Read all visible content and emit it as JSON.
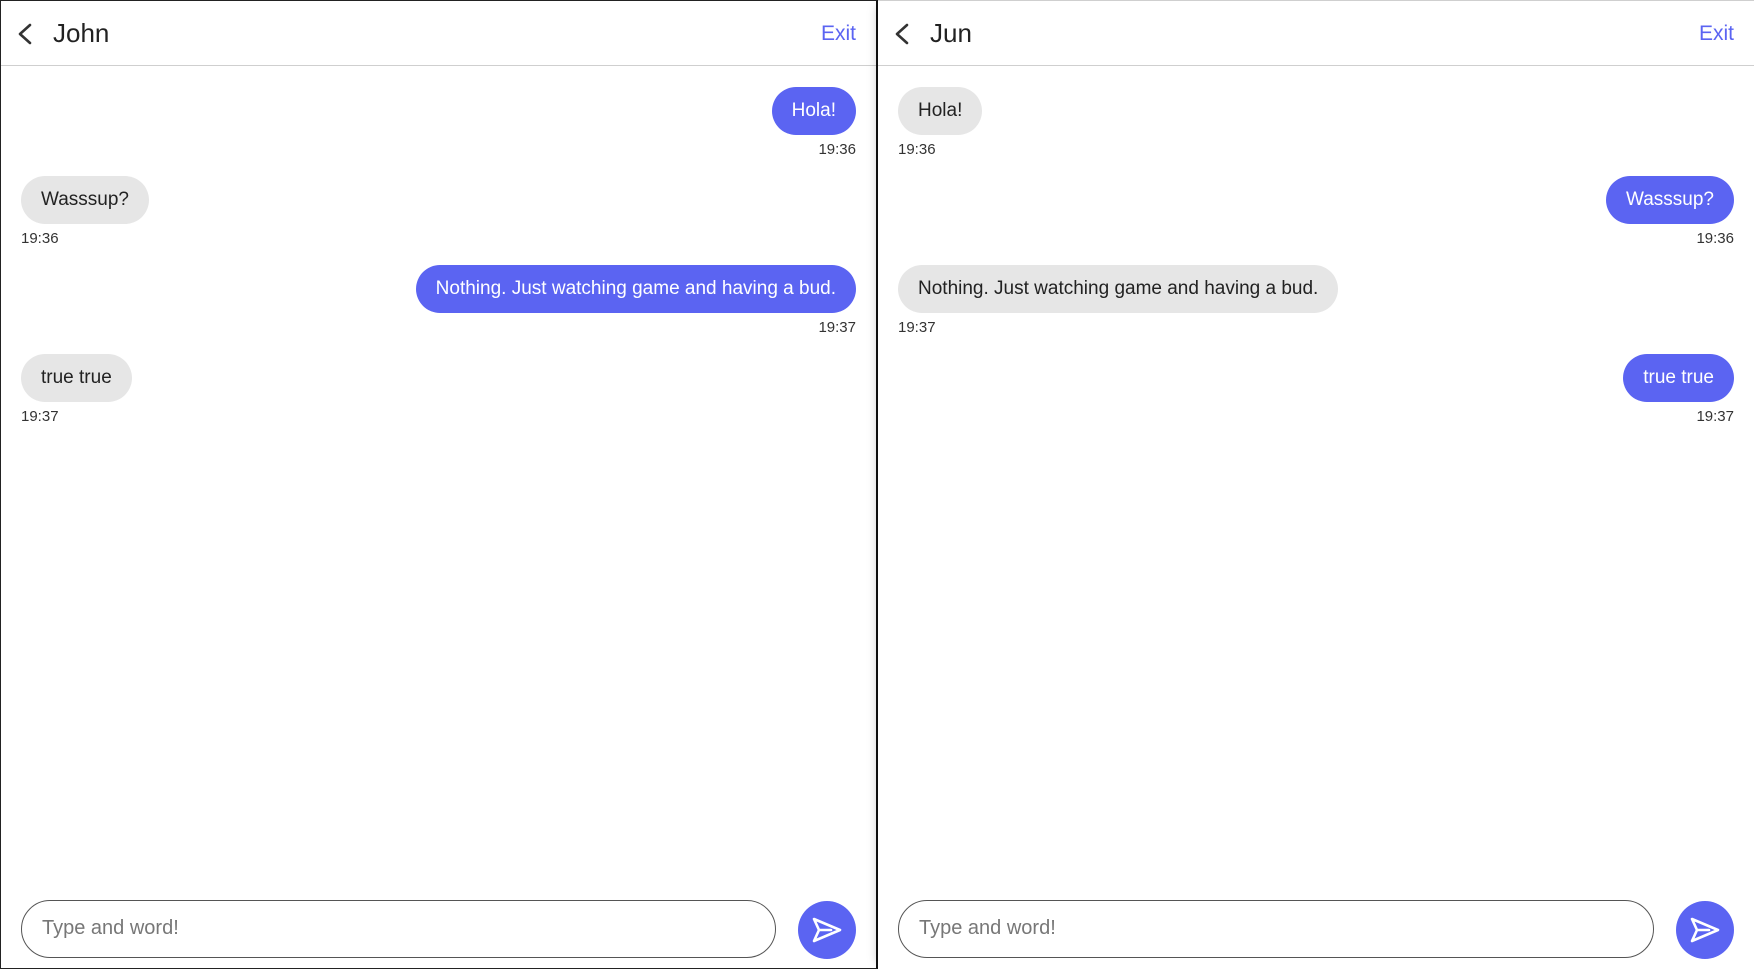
{
  "colors": {
    "accent": "#5b64f2",
    "received_bubble": "#e6e6e6",
    "text": "#222222"
  },
  "panes": [
    {
      "contact_name": "John",
      "exit_label": "Exit",
      "input_placeholder": "Type and word!",
      "input_value": "",
      "messages": [
        {
          "direction": "sent",
          "text": "Hola!",
          "time": "19:36"
        },
        {
          "direction": "received",
          "text": "Wasssup?",
          "time": "19:36"
        },
        {
          "direction": "sent",
          "text": "Nothing. Just watching game and having a bud.",
          "time": "19:37"
        },
        {
          "direction": "received",
          "text": "true true",
          "time": "19:37"
        }
      ],
      "icons": {
        "back": "chevron-left-icon",
        "send": "send-icon"
      }
    },
    {
      "contact_name": "Jun",
      "exit_label": "Exit",
      "input_placeholder": "Type and word!",
      "input_value": "",
      "messages": [
        {
          "direction": "received",
          "text": "Hola!",
          "time": "19:36"
        },
        {
          "direction": "sent",
          "text": "Wasssup?",
          "time": "19:36"
        },
        {
          "direction": "received",
          "text": "Nothing. Just watching game and having a bud.",
          "time": "19:37"
        },
        {
          "direction": "sent",
          "text": "true true",
          "time": "19:37"
        }
      ],
      "icons": {
        "back": "chevron-left-icon",
        "send": "send-icon"
      }
    }
  ]
}
